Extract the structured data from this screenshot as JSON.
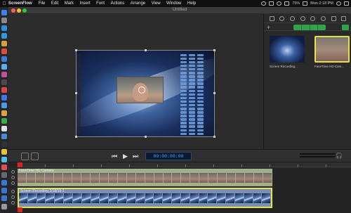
{
  "menubar": {
    "app_name": "ScreenFlow",
    "items": [
      "File",
      "Edit",
      "Mark",
      "Insert",
      "Font",
      "Actions",
      "Arrange",
      "View",
      "Window",
      "Help"
    ],
    "battery": "75%",
    "clock": "Mon 2:18 PM"
  },
  "window": {
    "title": "Untitled"
  },
  "media": {
    "items": [
      {
        "label": "Screen Recording..."
      },
      {
        "label": "FaceTime HD Cam..."
      }
    ]
  },
  "transport": {
    "timecode": "00:00:00",
    "timecode_frames": "00"
  },
  "timeline": {
    "tracks": [
      {
        "label": "FaceTime HD Camera"
      },
      {
        "label": "Screen Recording 2/18/15-1"
      }
    ]
  },
  "colors": {
    "accent_green": "#2fa44a",
    "selection_yellow": "#e6e14a",
    "playhead_red": "#dd2222",
    "timecode_blue": "#4aa0ff",
    "track_green": "#9fb08a",
    "track_blue": "#7b8fb3"
  }
}
